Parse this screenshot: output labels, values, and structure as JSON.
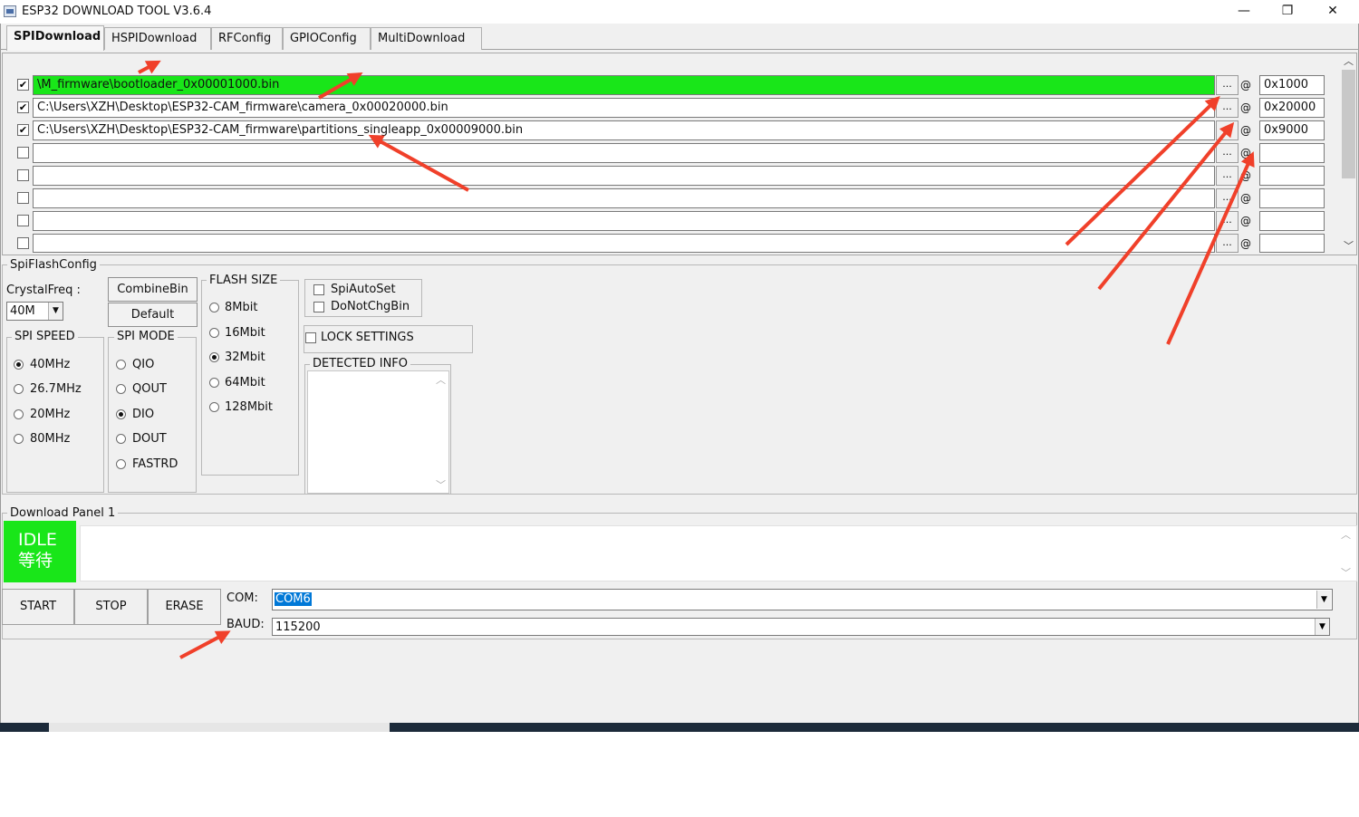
{
  "window": {
    "title": "ESP32 DOWNLOAD TOOL V3.6.4",
    "minimize": "—",
    "restore": "❐",
    "close": "✕"
  },
  "tabs": [
    {
      "label": "SPIDownload"
    },
    {
      "label": "HSPIDownload"
    },
    {
      "label": "RFConfig"
    },
    {
      "label": "GPIOConfig"
    },
    {
      "label": "MultiDownload"
    }
  ],
  "files": [
    {
      "checked": "✔",
      "path": "\\M_firmware\\bootloader_0x00001000.bin",
      "address": "0x1000"
    },
    {
      "checked": "✔",
      "path": "C:\\Users\\XZH\\Desktop\\ESP32-CAM_firmware\\camera_0x00020000.bin",
      "address": "0x20000"
    },
    {
      "checked": "✔",
      "path": "C:\\Users\\XZH\\Desktop\\ESP32-CAM_firmware\\partitions_singleapp_0x00009000.bin",
      "address": "0x9000"
    },
    {
      "checked": "",
      "path": "",
      "address": ""
    },
    {
      "checked": "",
      "path": "",
      "address": ""
    },
    {
      "checked": "",
      "path": "",
      "address": ""
    },
    {
      "checked": "",
      "path": "",
      "address": ""
    },
    {
      "checked": "",
      "path": "",
      "address": ""
    }
  ],
  "browse_label": "...",
  "at_symbol": "@",
  "spi_flash_config": {
    "title": "SpiFlashConfig",
    "crystal_label": "CrystalFreq :",
    "crystal_value": "40M",
    "combine_button": "CombineBin",
    "default_button": "Default",
    "spi_speed": {
      "title": "SPI SPEED",
      "options": [
        "40MHz",
        "26.7MHz",
        "20MHz",
        "80MHz"
      ],
      "selected": "40MHz"
    },
    "spi_mode": {
      "title": "SPI MODE",
      "options": [
        "QIO",
        "QOUT",
        "DIO",
        "DOUT",
        "FASTRD"
      ],
      "selected": "DIO"
    },
    "flash_size": {
      "title": "FLASH SIZE",
      "options": [
        "8Mbit",
        "16Mbit",
        "32Mbit",
        "64Mbit",
        "128Mbit"
      ],
      "selected": "32Mbit"
    },
    "spi_auto_set": "SpiAutoSet",
    "do_not_chg_bin": "DoNotChgBin",
    "lock_settings": "LOCK SETTINGS",
    "detected_info": "DETECTED INFO"
  },
  "download_panel": {
    "title": "Download Panel 1",
    "status_en": "IDLE",
    "status_cn": "等待",
    "start": "START",
    "stop": "STOP",
    "erase": "ERASE",
    "com_label": "COM:",
    "com_value": "COM6",
    "baud_label": "BAUD:",
    "baud_value": "115200"
  },
  "colors": {
    "highlight_green": "#19e619",
    "arrow_red": "#f0402a",
    "selection_blue": "#0078d7"
  },
  "icons": {
    "dropdown": "▼",
    "scroll_up": "︿",
    "scroll_down": "﹀"
  }
}
